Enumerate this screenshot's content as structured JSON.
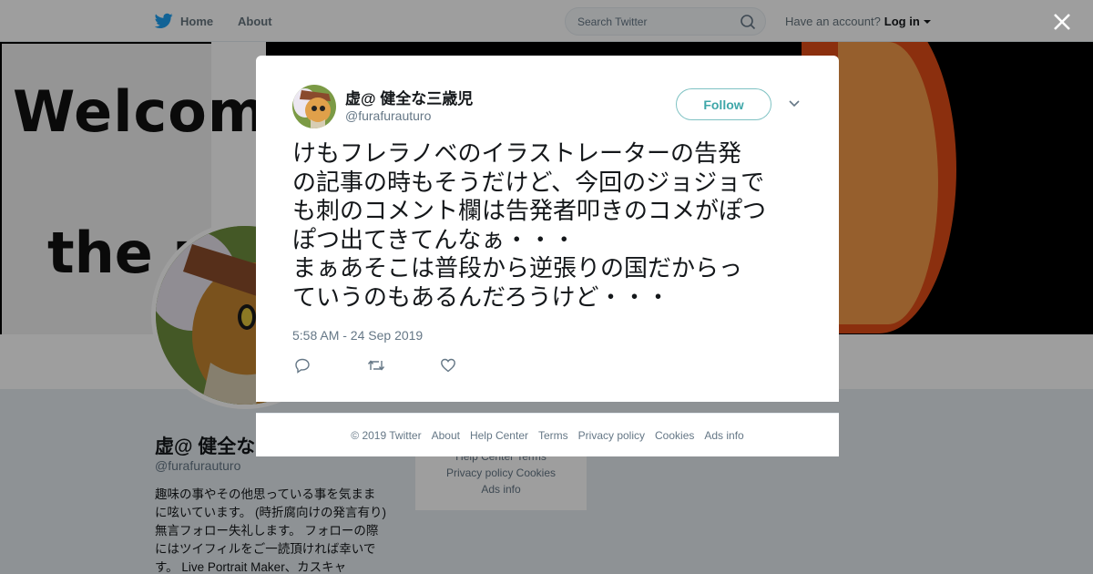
{
  "nav": {
    "home": "Home",
    "about": "About",
    "search_placeholder": "Search Twitter",
    "have_account": "Have an account?",
    "login": "Log in"
  },
  "banner": {
    "line1": "Welcom t",
    "line2": "the m"
  },
  "profile": {
    "name": "虚@ 健全な",
    "handle": "@furafurauturo",
    "bio": "趣味の事やその他思っている事を気ままに呟いています。 (時折腐向けの発言有り) 無言フォロー失礼します。 フォローの際にはツイフィルをご一読頂ければ幸いです。 Live Portrait Maker、カスキャ"
  },
  "side_footer": {
    "row1": "Help Center  Terms",
    "row2": "Privacy policy  Cookies",
    "row3": "Ads info"
  },
  "tweet": {
    "name": "虚@ 健全な三歳児",
    "handle": "@furafurauturo",
    "follow": "Follow",
    "text": "けもフレラノベのイラストレーターの告発\nの記事の時もそうだけど、今回のジョジョで\nも刺のコメント欄は告発者叩きのコメがぽつ\nぽつ出てきてんなぁ・・・\nまぁあそこは普段から逆張りの国だからっ\nていうのもあるんだろうけど・・・",
    "timestamp": "5:58 AM - 24 Sep 2019"
  },
  "footer": {
    "copyright": "© 2019 Twitter",
    "about": "About",
    "help": "Help Center",
    "terms": "Terms",
    "privacy": "Privacy policy",
    "cookies": "Cookies",
    "ads": "Ads info"
  },
  "colors": {
    "brand": "#1da1f2",
    "follow_border": "#7fc2c3",
    "follow_text": "#3fa7a9",
    "text_secondary": "#657786"
  }
}
